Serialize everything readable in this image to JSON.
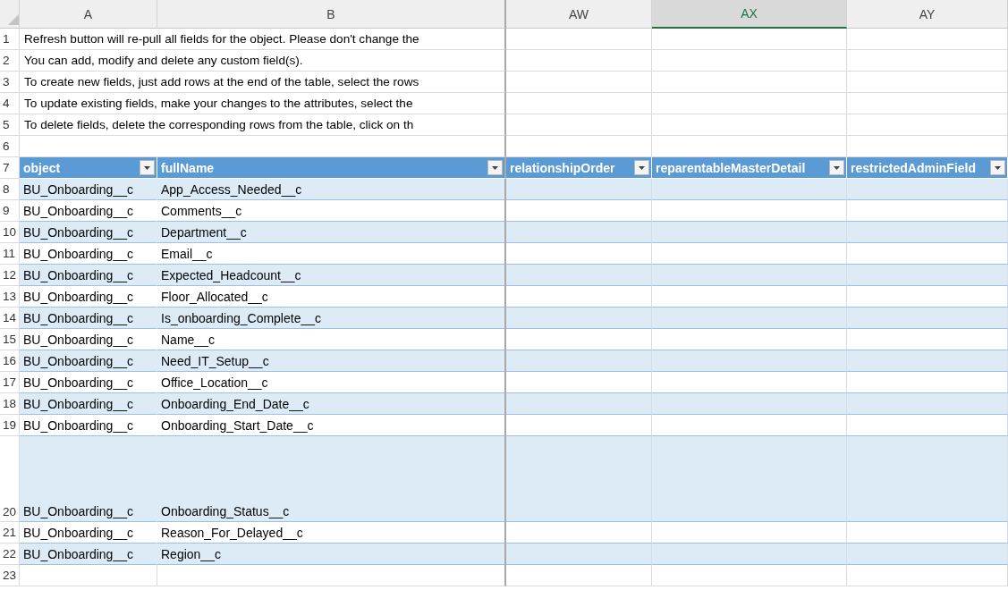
{
  "column_headers": [
    {
      "label": "A",
      "selected": false
    },
    {
      "label": "B",
      "selected": false
    },
    {
      "label": "AW",
      "selected": false
    },
    {
      "label": "AX",
      "selected": true
    },
    {
      "label": "AY",
      "selected": false
    }
  ],
  "notes": [
    {
      "row": "1",
      "text": "Refresh button will re-pull all fields for the object. Please don't change the"
    },
    {
      "row": "2",
      "text": "You can add, modify and delete any custom field(s)."
    },
    {
      "row": "3",
      "text": "To create new fields, just add rows at the end of the table, select the rows"
    },
    {
      "row": "4",
      "text": "To update existing fields, make your changes to the attributes, select the"
    },
    {
      "row": "5",
      "text": "To delete fields, delete the corresponding rows from the table, click on th"
    },
    {
      "row": "6"
    }
  ],
  "table": {
    "header_row": "7",
    "columns": [
      "object",
      "fullName",
      "relationshipOrder",
      "reparentableMasterDetail",
      "restrictedAdminField"
    ],
    "rows": [
      {
        "row": "8",
        "tall": false,
        "cells": [
          "BU_Onboarding__c",
          "App_Access_Needed__c"
        ]
      },
      {
        "row": "9",
        "tall": false,
        "cells": [
          "BU_Onboarding__c",
          "Comments__c"
        ]
      },
      {
        "row": "10",
        "tall": false,
        "cells": [
          "BU_Onboarding__c",
          "Department__c"
        ]
      },
      {
        "row": "11",
        "tall": false,
        "cells": [
          "BU_Onboarding__c",
          "Email__c"
        ]
      },
      {
        "row": "12",
        "tall": false,
        "cells": [
          "BU_Onboarding__c",
          "Expected_Headcount__c"
        ]
      },
      {
        "row": "13",
        "tall": false,
        "cells": [
          "BU_Onboarding__c",
          "Floor_Allocated__c"
        ]
      },
      {
        "row": "14",
        "tall": false,
        "cells": [
          "BU_Onboarding__c",
          "Is_onboarding_Complete__c"
        ]
      },
      {
        "row": "15",
        "tall": false,
        "cells": [
          "BU_Onboarding__c",
          "Name__c"
        ]
      },
      {
        "row": "16",
        "tall": false,
        "cells": [
          "BU_Onboarding__c",
          "Need_IT_Setup__c"
        ]
      },
      {
        "row": "17",
        "tall": false,
        "cells": [
          "BU_Onboarding__c",
          "Office_Location__c"
        ]
      },
      {
        "row": "18",
        "tall": false,
        "cells": [
          "BU_Onboarding__c",
          "Onboarding_End_Date__c"
        ]
      },
      {
        "row": "19",
        "tall": false,
        "cells": [
          "BU_Onboarding__c",
          "Onboarding_Start_Date__c"
        ]
      },
      {
        "row": "20",
        "tall": true,
        "cells": [
          "BU_Onboarding__c",
          "Onboarding_Status__c"
        ]
      },
      {
        "row": "21",
        "tall": false,
        "cells": [
          "BU_Onboarding__c",
          "Reason_For_Delayed__c"
        ]
      },
      {
        "row": "22",
        "tall": false,
        "cells": [
          "BU_Onboarding__c",
          "Region__c"
        ]
      }
    ]
  },
  "trailing_rows": [
    "23"
  ]
}
